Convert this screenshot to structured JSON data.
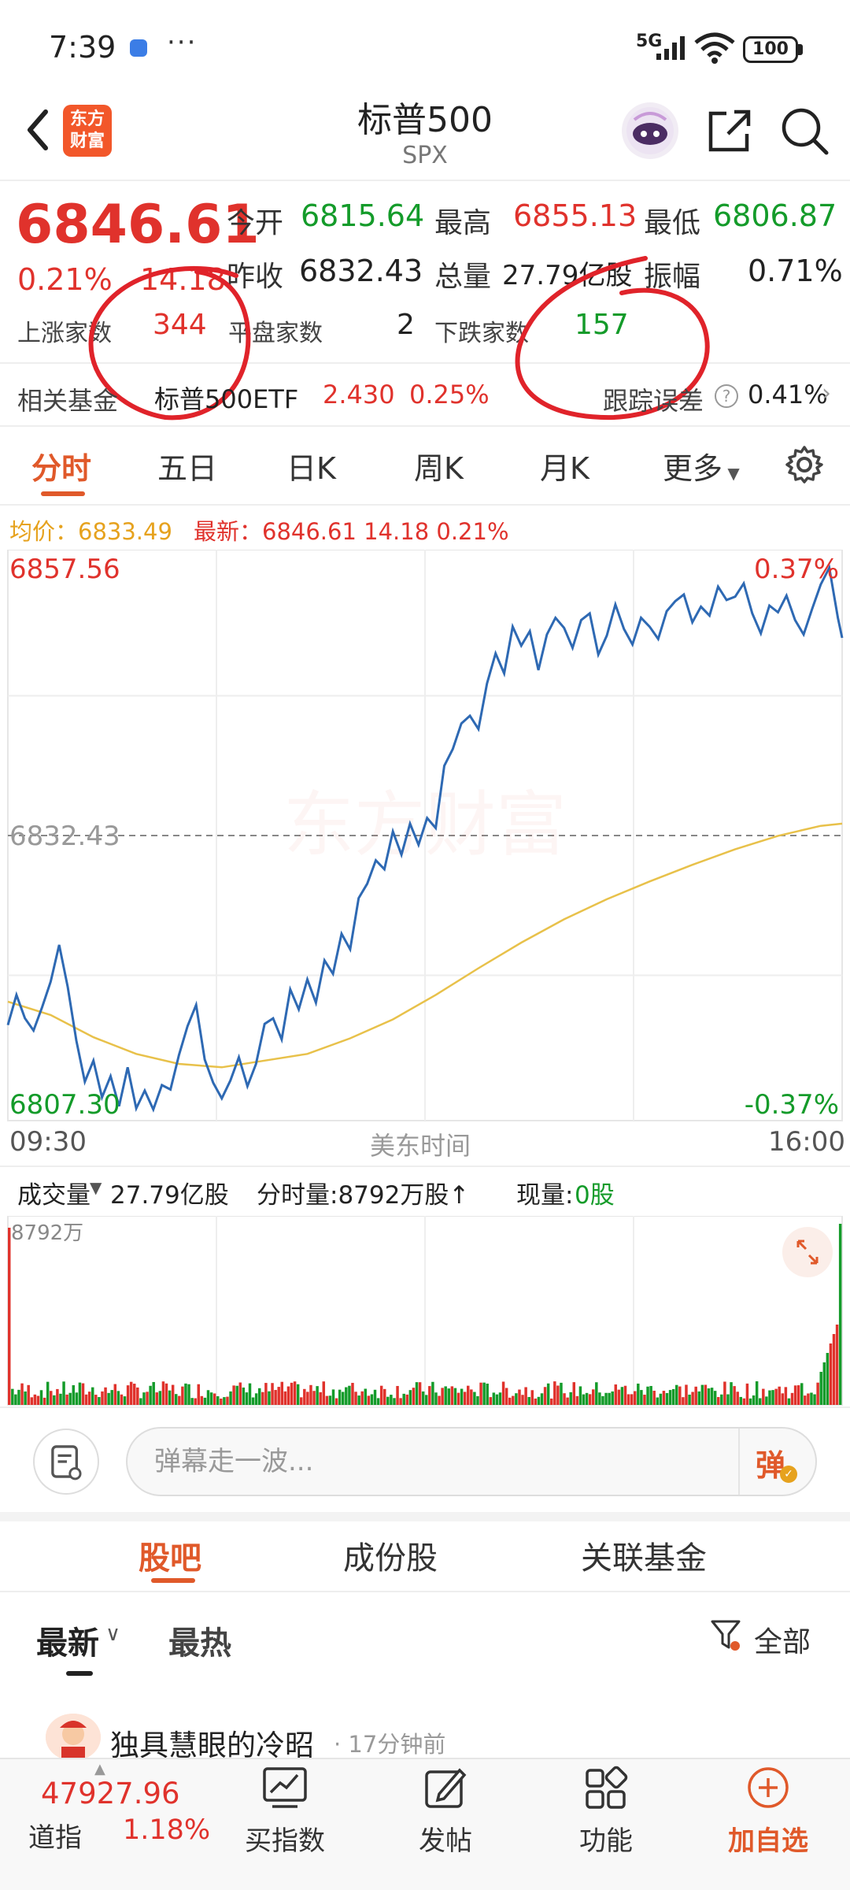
{
  "status_bar": {
    "time": "7:39",
    "more": "···",
    "network": "5G",
    "battery": "100"
  },
  "header": {
    "title": "标普500",
    "code": "SPX",
    "logo_text_1": "东方",
    "logo_text_2": "财富"
  },
  "quote": {
    "last_price": "6846.61",
    "change_pct": "0.21%",
    "change_amt": "14.18",
    "open_label": "今开",
    "open": "6815.64",
    "high_label": "最高",
    "high": "6855.13",
    "low_label": "最低",
    "low": "6806.87",
    "prev_close_label": "昨收",
    "prev_close": "6832.43",
    "volume_label": "总量",
    "volume": "27.79亿股",
    "amplitude_label": "振幅",
    "amplitude": "0.71%",
    "up_count_label": "上涨家数",
    "up_count": "344",
    "flat_count_label": "平盘家数",
    "flat_count": "2",
    "down_count_label": "下跌家数",
    "down_count": "157"
  },
  "fund_row": {
    "label": "相关基金",
    "fund_name": "标普500ETF",
    "fund_price": "2.430",
    "fund_change": "0.25%",
    "tracking_label": "跟踪误差",
    "tracking_value": "0.41%"
  },
  "chart_tabs": [
    "分时",
    "五日",
    "日K",
    "周K",
    "月K",
    "更多"
  ],
  "info_row": {
    "avg": "均价：6833.49",
    "latest": "最新：6846.61   14.18   0.21%"
  },
  "chart_data": {
    "type": "line",
    "x_start": "09:30",
    "x_mid": "美东时间",
    "x_end": "16:00",
    "ylim": [
      6807.3,
      6857.56
    ],
    "y_top_label": "6857.56",
    "y_mid_label": "6832.43",
    "y_bottom_label": "6807.30",
    "pct_top_label": "0.37%",
    "pct_bottom_label": "-0.37%",
    "reference": 6832.43,
    "series": [
      {
        "name": "price",
        "color": "#2e69b3",
        "x": [
          0,
          4,
          8,
          12,
          16,
          20,
          24,
          28,
          32,
          36,
          40,
          44,
          48,
          52,
          56,
          60,
          64,
          68,
          72,
          76,
          80,
          84,
          88,
          92,
          96,
          100,
          104,
          108,
          112,
          116,
          120,
          124,
          128,
          132,
          136,
          140,
          144,
          148,
          152,
          156,
          160,
          164,
          168,
          172,
          176,
          180,
          184,
          188,
          192,
          196,
          200,
          204,
          208,
          212,
          216,
          220,
          224,
          228,
          232,
          236,
          240,
          244,
          248,
          252,
          256,
          260,
          264,
          268,
          272,
          276,
          280,
          284,
          288,
          292,
          296,
          300,
          304,
          308,
          312,
          316,
          320,
          324,
          328,
          332,
          336,
          340,
          344,
          348,
          352,
          356,
          360,
          364,
          368,
          372,
          376,
          380,
          384,
          388,
          390
        ],
        "values": [
          6815.4,
          6818.1,
          6816.0,
          6814.9,
          6817.0,
          6819.3,
          6822.6,
          6818.8,
          6814.0,
          6810.3,
          6812.2,
          6808.9,
          6810.8,
          6808.1,
          6811.6,
          6807.9,
          6809.5,
          6807.8,
          6810.0,
          6809.6,
          6812.7,
          6815.3,
          6817.2,
          6812.3,
          6810.2,
          6808.8,
          6810.4,
          6812.5,
          6809.9,
          6811.9,
          6815.5,
          6816.0,
          6814.1,
          6818.6,
          6816.8,
          6819.5,
          6817.4,
          6821.2,
          6820.0,
          6823.6,
          6822.2,
          6826.8,
          6828.1,
          6830.2,
          6829.4,
          6832.8,
          6830.7,
          6833.5,
          6831.6,
          6834.0,
          6833.1,
          6838.7,
          6840.2,
          6842.5,
          6843.2,
          6842.0,
          6846.1,
          6848.8,
          6847.0,
          6851.2,
          6849.5,
          6850.8,
          6847.3,
          6850.5,
          6852.0,
          6851.1,
          6849.3,
          6851.8,
          6852.4,
          6848.7,
          6850.4,
          6853.2,
          6851.0,
          6849.6,
          6852.0,
          6851.2,
          6850.1,
          6852.6,
          6853.5,
          6854.1,
          6851.6,
          6853.0,
          6852.2,
          6854.8,
          6853.6,
          6853.9,
          6855.1,
          6852.4,
          6850.6,
          6853.1,
          6852.5,
          6854.0,
          6851.8,
          6850.5,
          6852.8,
          6855.0,
          6856.5,
          6852.0,
          6850.2
        ]
      },
      {
        "name": "average",
        "color": "#e8c14a",
        "x": [
          0,
          20,
          40,
          60,
          80,
          100,
          120,
          140,
          160,
          180,
          200,
          220,
          240,
          260,
          280,
          300,
          320,
          340,
          360,
          380,
          390
        ],
        "values": [
          6817.5,
          6816.3,
          6814.3,
          6812.8,
          6811.9,
          6811.6,
          6812.2,
          6812.8,
          6814.2,
          6815.9,
          6818.1,
          6820.5,
          6822.8,
          6824.9,
          6826.7,
          6828.3,
          6829.8,
          6831.2,
          6832.4,
          6833.3,
          6833.5
        ]
      }
    ]
  },
  "volume": {
    "type_label": "成交量",
    "total": "27.79亿股",
    "minute_volume": "分时量:8792万股↑",
    "current_label": "现量:",
    "current_value": "0股",
    "max_label": "8792万"
  },
  "danmu": {
    "placeholder": "弹幕走一波...",
    "send_label": "弹"
  },
  "section_tabs": [
    "股吧",
    "成份股",
    "关联基金"
  ],
  "filters": {
    "latest": "最新",
    "hot": "最热",
    "all": "全部"
  },
  "post": {
    "author": "独具慧眼的冷昭",
    "time": "· 17分钟前"
  },
  "bottom_bar": {
    "dow_value": "47927.96",
    "dow_name": "道指",
    "dow_change": "1.18%",
    "nav": [
      "买指数",
      "发帖",
      "功能",
      "加自选"
    ]
  },
  "colors": {
    "up": "#e0322c",
    "down": "#149b2a",
    "accent": "#e0592a",
    "price_line": "#2e69b3",
    "avg_line": "#e8c14a"
  }
}
